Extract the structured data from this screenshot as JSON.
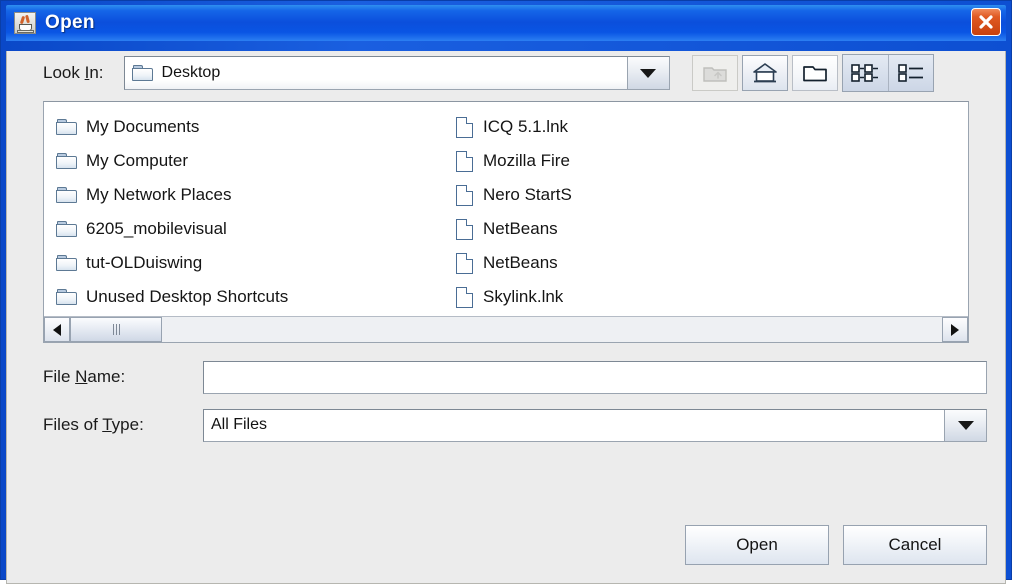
{
  "window": {
    "title": "Open",
    "app_icon": "java-coffee-cup-icon",
    "close_label": "×",
    "accent_color": "#0b4fdc",
    "body_color": "#ececec",
    "close_color": "#d9480f"
  },
  "lookin": {
    "label_before": "Look ",
    "label_mnemonic": "I",
    "label_after": "n:",
    "value": "Desktop",
    "icon": "folder-icon"
  },
  "toolbar": {
    "buttons": [
      {
        "name": "up-one-level-button",
        "icon": "folder-up-icon",
        "enabled": false
      },
      {
        "name": "home-button",
        "icon": "home-icon",
        "enabled": true
      },
      {
        "name": "create-new-folder-button",
        "icon": "new-folder-icon",
        "enabled": true
      },
      {
        "name": "list-view-button",
        "icon": "list-view-icon",
        "enabled": true
      },
      {
        "name": "details-view-button",
        "icon": "details-view-icon",
        "enabled": true
      }
    ]
  },
  "file_list": {
    "items": [
      {
        "name": "My Documents",
        "type": "folder"
      },
      {
        "name": "My Computer",
        "type": "folder"
      },
      {
        "name": "My Network Places",
        "type": "folder"
      },
      {
        "name": "6205_mobilevisual",
        "type": "folder"
      },
      {
        "name": "tut-OLDuiswing",
        "type": "folder"
      },
      {
        "name": "Unused Desktop Shortcuts",
        "type": "folder"
      },
      {
        "name": "ICQ 5.1.lnk",
        "type": "file"
      },
      {
        "name": "Mozilla Fire",
        "type": "file"
      },
      {
        "name": "Nero StartS",
        "type": "file"
      },
      {
        "name": "NetBeans",
        "type": "file"
      },
      {
        "name": "NetBeans",
        "type": "file"
      },
      {
        "name": "Skylink.lnk",
        "type": "file"
      }
    ],
    "scrollbar": {
      "orientation": "horizontal",
      "position": "left"
    }
  },
  "filename": {
    "label_before": "File ",
    "label_mnemonic": "N",
    "label_after": "ame:",
    "value": "",
    "placeholder": ""
  },
  "filetype": {
    "label_before": "Files of ",
    "label_mnemonic": "T",
    "label_after": "ype:",
    "value": "All Files"
  },
  "buttons": {
    "open": "Open",
    "cancel": "Cancel"
  }
}
